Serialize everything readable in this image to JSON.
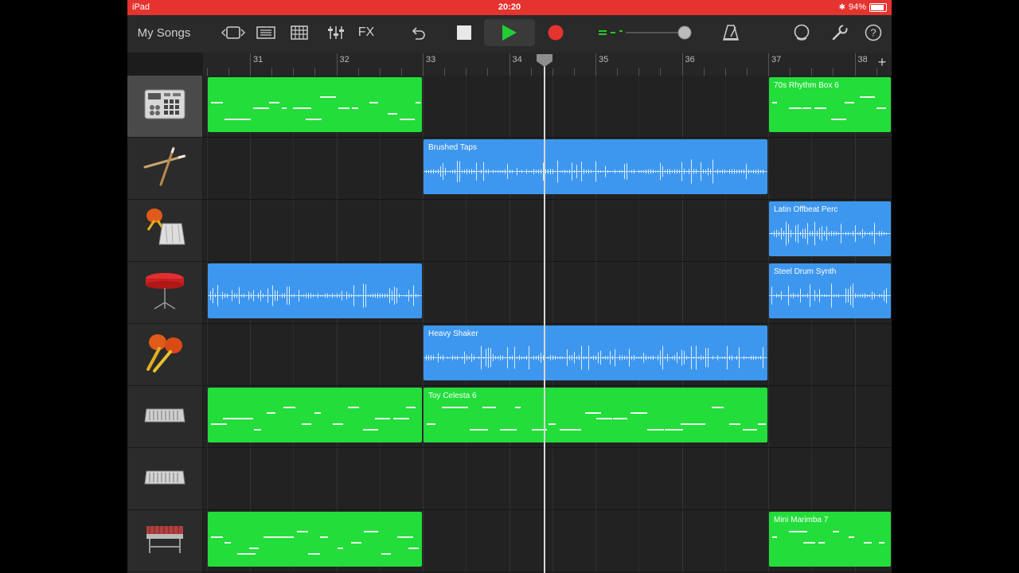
{
  "status_bar": {
    "device": "iPad",
    "time": "20:20",
    "battery": "94%"
  },
  "toolbar": {
    "my_songs": "My Songs",
    "fx": "FX"
  },
  "ruler": {
    "bars": [
      "31",
      "32",
      "33",
      "34",
      "35",
      "36",
      "37",
      "38"
    ]
  },
  "colors": {
    "midi_region": "#22dd3a",
    "audio_region": "#3e97ee",
    "record": "#e5332f",
    "play": "#22cc33",
    "status_bar": "#e5332f"
  },
  "tracks": [
    {
      "instrument_icon": "drum-machine-icon",
      "selected": true,
      "regions": [
        {
          "type": "midi",
          "name": "",
          "start_bar": 30.5,
          "end_bar": 33.0
        },
        {
          "type": "midi",
          "name": "70s Rhythm Box 6",
          "start_bar": 37.0,
          "end_bar": 38.5
        }
      ]
    },
    {
      "instrument_icon": "drumsticks-icon",
      "selected": false,
      "regions": [
        {
          "type": "audio",
          "name": "Brushed Taps",
          "start_bar": 33.0,
          "end_bar": 37.0
        }
      ]
    },
    {
      "instrument_icon": "maracas-cowbell-icon",
      "selected": false,
      "regions": [
        {
          "type": "audio",
          "name": "Latin Offbeat Perc",
          "start_bar": 37.0,
          "end_bar": 38.5
        }
      ]
    },
    {
      "instrument_icon": "steel-drum-icon",
      "selected": false,
      "regions": [
        {
          "type": "audio",
          "name": "",
          "start_bar": 30.5,
          "end_bar": 33.0
        },
        {
          "type": "audio",
          "name": "Steel Drum Synth",
          "start_bar": 37.0,
          "end_bar": 38.5
        }
      ]
    },
    {
      "instrument_icon": "maracas-icon",
      "selected": false,
      "regions": [
        {
          "type": "audio",
          "name": "Heavy Shaker",
          "start_bar": 33.0,
          "end_bar": 37.0
        }
      ]
    },
    {
      "instrument_icon": "celesta-icon",
      "selected": false,
      "regions": [
        {
          "type": "midi",
          "name": "",
          "start_bar": 30.5,
          "end_bar": 33.0
        },
        {
          "type": "midi",
          "name": "Toy Celesta 6",
          "start_bar": 33.0,
          "end_bar": 37.0
        }
      ]
    },
    {
      "instrument_icon": "keyboard-icon",
      "selected": false,
      "regions": []
    },
    {
      "instrument_icon": "marimba-icon",
      "selected": false,
      "regions": [
        {
          "type": "midi",
          "name": "",
          "start_bar": 30.5,
          "end_bar": 33.0
        },
        {
          "type": "midi",
          "name": "Mini Marimba 7",
          "start_bar": 37.0,
          "end_bar": 38.5
        }
      ]
    }
  ],
  "playhead_bar": 34.4
}
